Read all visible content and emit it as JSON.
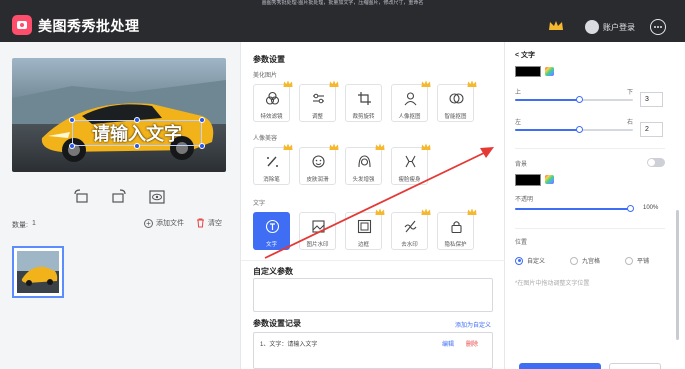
{
  "colors": {
    "titlebar": "#2a2b2f",
    "accent": "#3f6ef5",
    "crown": "#f5b82e",
    "arrow": "#e53935"
  },
  "header": {
    "strip_text": "画图秀秀批处理·图片批处理，批量加文字，压缩图片，修改尺寸，重命名",
    "app_title": "美图秀秀批处理",
    "login_label": "账户登录"
  },
  "left": {
    "preview_text": "请输入文字",
    "quantity_label": "数量:",
    "quantity_value": "1",
    "add_file_label": "添加文件",
    "clear_label": "清空"
  },
  "middle": {
    "params_title": "参数设置",
    "group_beauty": "美化图片",
    "group_portrait": "人像美容",
    "group_text": "文字",
    "beauty_items": [
      {
        "label": "特效滤镜",
        "icon": "filter-icon",
        "vip": true
      },
      {
        "label": "调整",
        "icon": "adjust-icon",
        "vip": true
      },
      {
        "label": "裁剪旋转",
        "icon": "crop-icon",
        "vip": false
      },
      {
        "label": "人像抠图",
        "icon": "cutout-icon",
        "vip": true
      },
      {
        "label": "智能抠图",
        "icon": "smart-cutout-icon",
        "vip": true
      }
    ],
    "portrait_items": [
      {
        "label": "消除笔",
        "icon": "eraser-icon",
        "vip": true
      },
      {
        "label": "皮肤润滑",
        "icon": "skin-icon",
        "vip": true
      },
      {
        "label": "头发增强",
        "icon": "hair-icon",
        "vip": true
      },
      {
        "label": "瘦脸瘦身",
        "icon": "slim-icon",
        "vip": true
      }
    ],
    "text_items": [
      {
        "label": "文字",
        "icon": "text-icon",
        "vip": false,
        "active": true
      },
      {
        "label": "图片水印",
        "icon": "image-watermark-icon",
        "vip": false
      },
      {
        "label": "边框",
        "icon": "border-icon",
        "vip": true
      },
      {
        "label": "去水印",
        "icon": "remove-watermark-icon",
        "vip": true
      },
      {
        "label": "隐私保护",
        "icon": "privacy-icon",
        "vip": true
      }
    ],
    "custom_title": "自定义参数",
    "record_title": "参数设置记录",
    "add_custom_label": "添加为自定义",
    "record_entry": "1、文字：请输入文字",
    "record_edit": "编辑",
    "record_delete": "删除"
  },
  "right": {
    "title": "< 文字",
    "up_label": "上",
    "down_label": "下",
    "vertical_value": "3",
    "left_label": "左",
    "right_label": "右",
    "horizontal_value": "2",
    "background_label": "背景",
    "opacity_label": "不透明",
    "opacity_value": "100%",
    "position_label": "位置",
    "pos_options": [
      "自定义",
      "九宫格",
      "平铺"
    ],
    "pos_selected": 0,
    "hint": "*在图片中拖动调整文字位置",
    "vertical_slider": 0.55,
    "horizontal_slider": 0.55,
    "opacity_slider": 1.0
  }
}
